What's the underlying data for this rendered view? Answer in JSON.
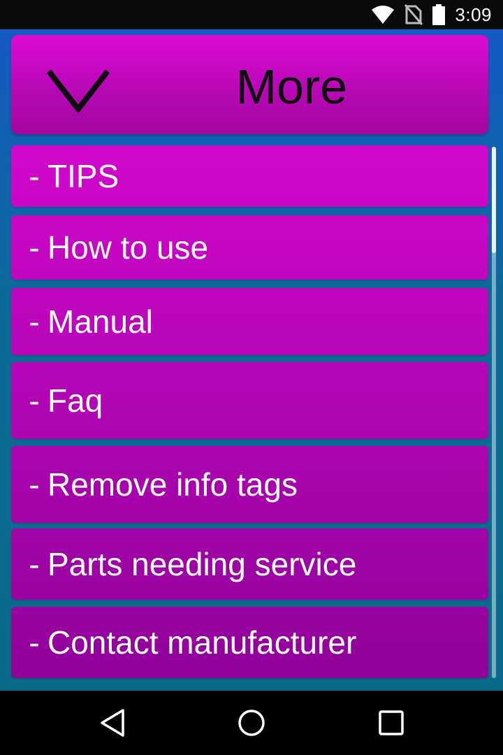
{
  "status_bar": {
    "time": "3:09",
    "icons": [
      "wifi-icon",
      "no-sim-icon",
      "battery-icon"
    ]
  },
  "header": {
    "title": "More",
    "collapse_icon": "chevron-down-icon"
  },
  "menu": {
    "dash": "-",
    "items": [
      {
        "label": "TIPS"
      },
      {
        "label": "How to use"
      },
      {
        "label": "Manual"
      },
      {
        "label": "Faq"
      },
      {
        "label": "Remove info tags"
      },
      {
        "label": "Parts needing service"
      },
      {
        "label": "Contact manufacturer"
      }
    ]
  },
  "nav_bar": {
    "icons": [
      "back-icon",
      "home-icon",
      "recents-icon"
    ]
  },
  "colors": {
    "item_top": "#d108cc",
    "item_bottom": "#90029a",
    "background_top": "#1459c4",
    "background_bottom": "#0a6a8a",
    "header_text": "#0d0d0d",
    "item_text": "#ffffff"
  }
}
